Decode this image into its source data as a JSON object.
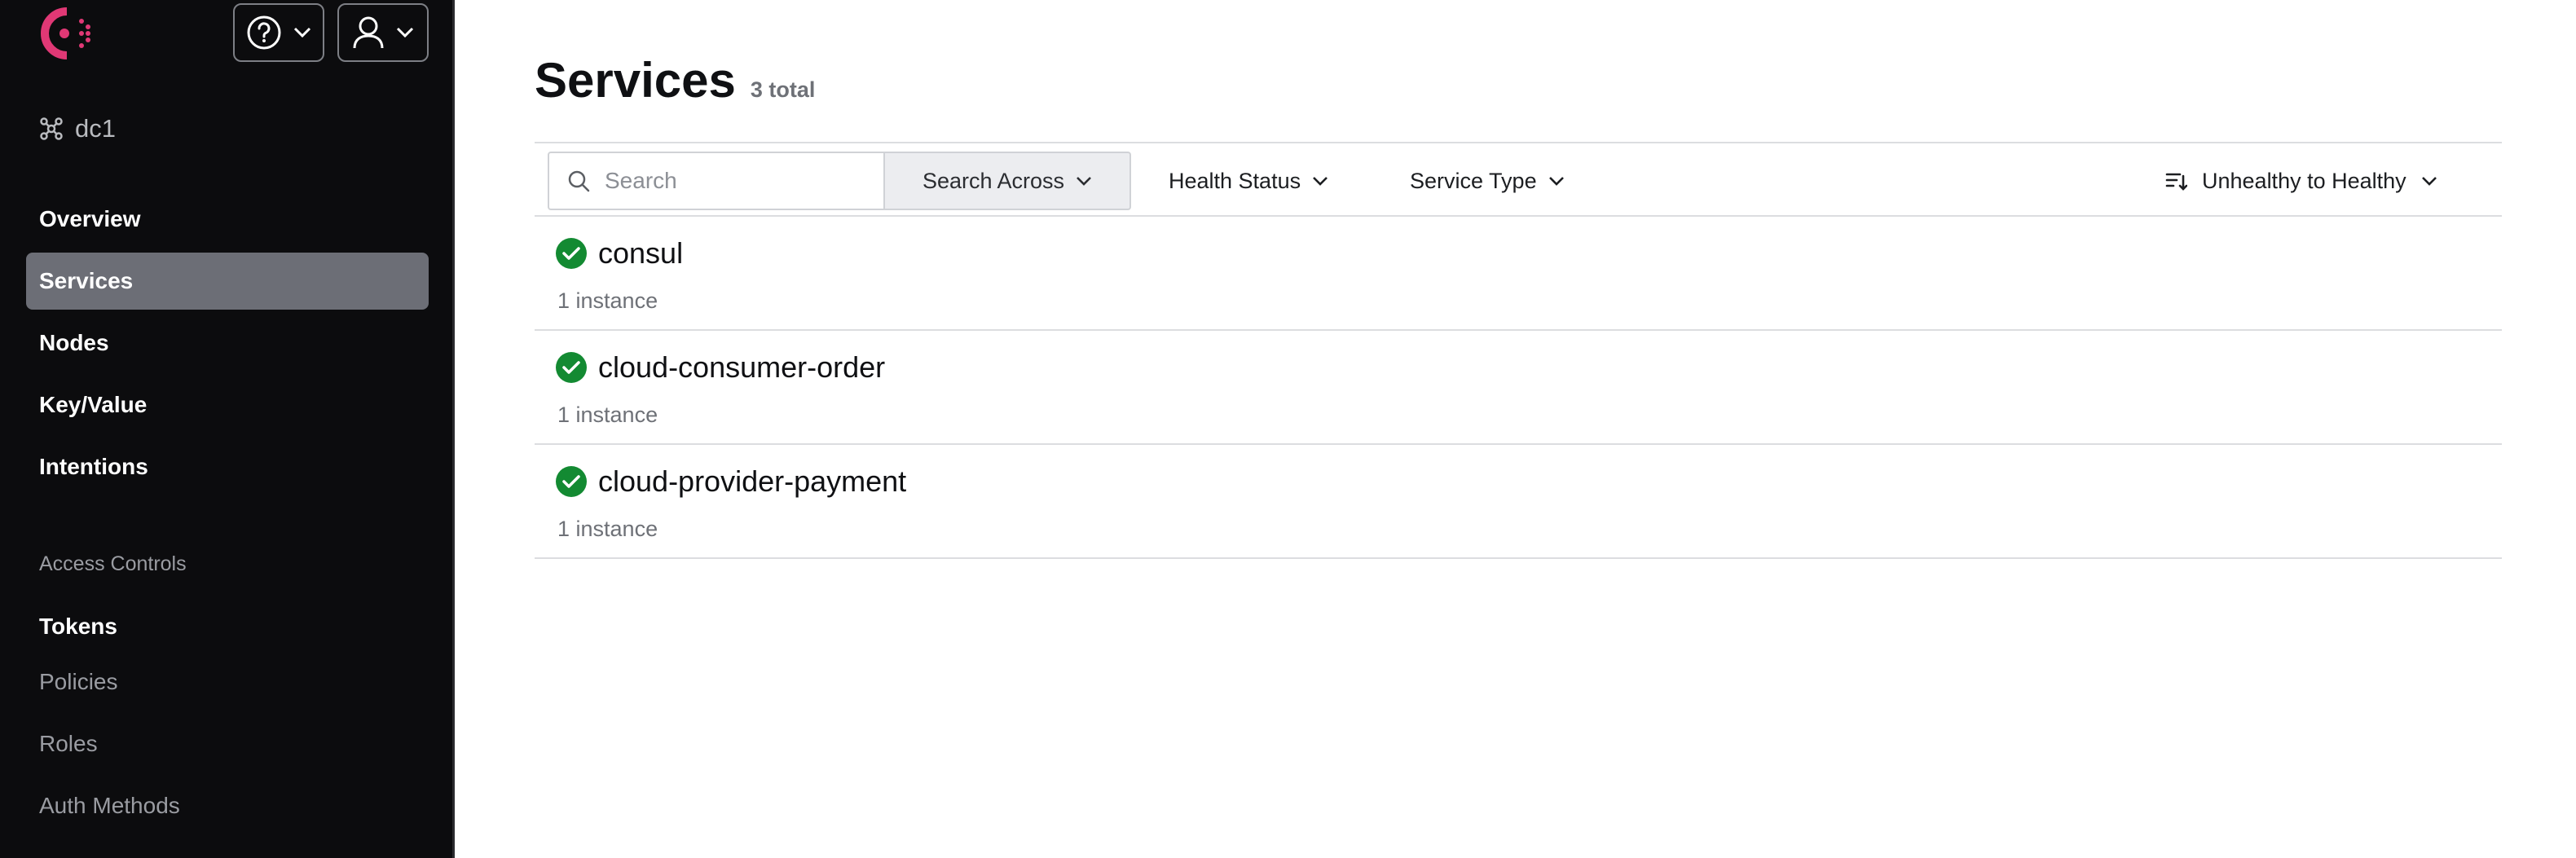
{
  "header": {
    "help_icon": "help-circle-icon",
    "user_icon": "user-icon"
  },
  "sidebar": {
    "datacenter": "dc1",
    "nav": [
      {
        "label": "Overview"
      },
      {
        "label": "Services",
        "active": true
      },
      {
        "label": "Nodes"
      },
      {
        "label": "Key/Value"
      },
      {
        "label": "Intentions"
      }
    ],
    "access_section": "Access Controls",
    "access": [
      {
        "label": "Tokens"
      },
      {
        "label": "Policies"
      },
      {
        "label": "Roles"
      },
      {
        "label": "Auth Methods"
      }
    ]
  },
  "main": {
    "title": "Services",
    "total": "3 total",
    "search": {
      "placeholder": "Search",
      "value": ""
    },
    "search_across": "Search Across",
    "health_status": "Health Status",
    "service_type": "Service Type",
    "sort": "Unhealthy to Healthy",
    "services": [
      {
        "name": "consul",
        "instances": "1 instance",
        "status": "passing"
      },
      {
        "name": "cloud-consumer-order",
        "instances": "1 instance",
        "status": "passing"
      },
      {
        "name": "cloud-provider-payment",
        "instances": "1 instance",
        "status": "passing"
      }
    ]
  },
  "colors": {
    "brand": "#e03875",
    "sidebar_bg": "#0c0c0e",
    "active_nav": "#6c6e76",
    "passing": "#138a32"
  }
}
